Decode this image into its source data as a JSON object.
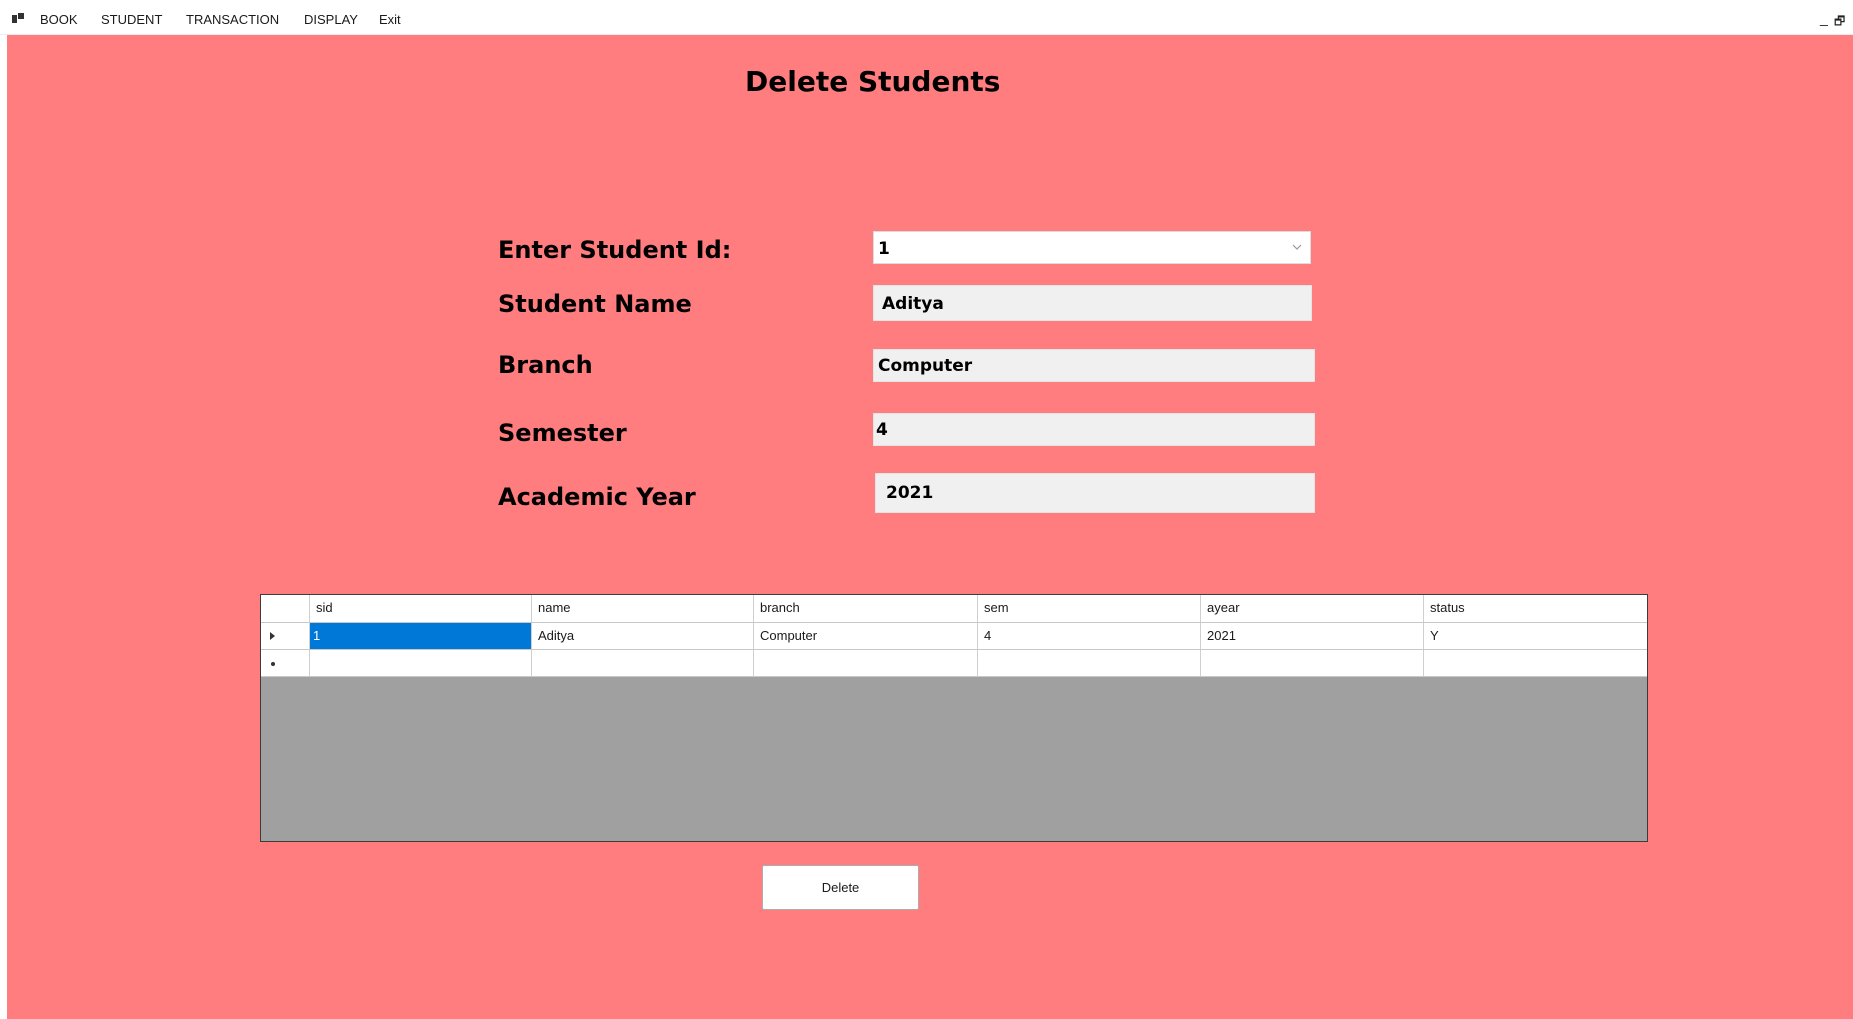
{
  "menu": {
    "items": [
      "BOOK",
      "STUDENT",
      "TRANSACTION",
      "DISPLAY",
      "Exit"
    ],
    "icon": "app-icon",
    "minimize_glyph": "_",
    "restore_glyph": "🗗"
  },
  "colors": {
    "form_background": "#ff7d7e",
    "grid_background": "#a0a0a0",
    "selection": "#0078d7",
    "textbox_background": "#f0f0f0"
  },
  "page": {
    "title": "Delete Students"
  },
  "form": {
    "student_id": {
      "label": "Enter Student Id:",
      "value": "1"
    },
    "student_name": {
      "label": "Student Name",
      "value": "Aditya"
    },
    "branch": {
      "label": "Branch",
      "value": "Computer"
    },
    "semester": {
      "label": "Semester",
      "value": "4"
    },
    "academic_year": {
      "label": "Academic Year",
      "value": "2021"
    }
  },
  "grid": {
    "columns": [
      "sid",
      "name",
      "branch",
      "sem",
      "ayear",
      "status"
    ],
    "rows": [
      [
        "1",
        "Aditya",
        "Computer",
        "4",
        "2021",
        "Y"
      ]
    ],
    "current_row_indicator": "right-triangle-icon",
    "new_row_indicator": "new-row-asterisk-icon"
  },
  "actions": {
    "delete_label": "Delete"
  }
}
